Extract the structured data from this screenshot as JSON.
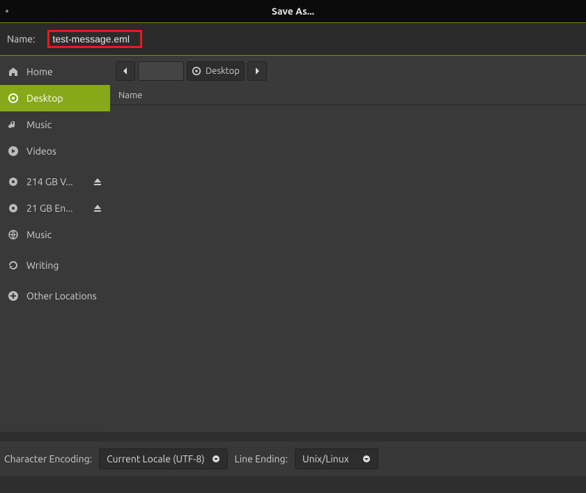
{
  "window": {
    "title": "Save As..."
  },
  "nameRow": {
    "label": "Name:",
    "value": "test-message.eml"
  },
  "sidebar": {
    "items": [
      {
        "icon": "home",
        "label": "Home",
        "active": false
      },
      {
        "icon": "desktop",
        "label": "Desktop",
        "active": true
      },
      {
        "icon": "music",
        "label": "Music",
        "active": false
      },
      {
        "icon": "videos",
        "label": "Videos",
        "active": false
      }
    ],
    "volumes": [
      {
        "icon": "disk",
        "label": "214 GB V...",
        "eject": true
      },
      {
        "icon": "disk",
        "label": "21 GB En...",
        "eject": true
      },
      {
        "icon": "network",
        "label": "Music",
        "eject": false
      }
    ],
    "other": [
      {
        "icon": "refresh",
        "label": "Writing"
      },
      {
        "icon": "plus",
        "label": "Other Locations"
      }
    ]
  },
  "pathbar": {
    "location": "Desktop"
  },
  "columns": {
    "name": "Name"
  },
  "footer": {
    "encodingLabel": "Character Encoding:",
    "encodingValue": "Current Locale (UTF-8)",
    "lineEndingLabel": "Line Ending:",
    "lineEndingValue": "Unix/Linux"
  }
}
